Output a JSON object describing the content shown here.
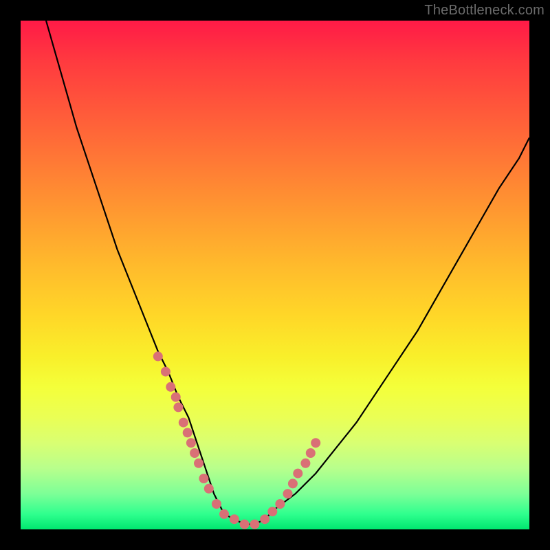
{
  "watermark": "TheBottleneck.com",
  "colors": {
    "frame": "#000000",
    "curve_stroke": "#000000",
    "dot_fill": "#d97076",
    "gradient_top": "#ff1a47",
    "gradient_bottom": "#00e66f"
  },
  "chart_data": {
    "type": "line",
    "title": "",
    "xlabel": "",
    "ylabel": "",
    "xlim": [
      0,
      100
    ],
    "ylim": [
      0,
      100
    ],
    "grid": false,
    "legend": false,
    "x": [
      5,
      7,
      9,
      11,
      13,
      15,
      17,
      19,
      21,
      23,
      25,
      27,
      29,
      31,
      33,
      34,
      35,
      36,
      37,
      38,
      39,
      40,
      42,
      44,
      46,
      48,
      50,
      54,
      58,
      62,
      66,
      70,
      74,
      78,
      82,
      86,
      90,
      94,
      98,
      100
    ],
    "values": [
      100,
      93,
      86,
      79,
      73,
      67,
      61,
      55,
      50,
      45,
      40,
      35,
      31,
      26,
      22,
      19,
      16,
      13,
      10,
      7,
      5,
      3,
      2,
      1,
      1,
      2,
      4,
      7,
      11,
      16,
      21,
      27,
      33,
      39,
      46,
      53,
      60,
      67,
      73,
      77
    ],
    "dots": {
      "x": [
        27,
        28.5,
        29.5,
        30.5,
        31,
        32,
        32.8,
        33.5,
        34.2,
        35,
        36,
        37,
        38.5,
        40,
        42,
        44,
        46,
        48,
        49.5,
        51,
        52.5,
        53.5,
        54.5,
        56,
        57,
        58
      ],
      "y": [
        34,
        31,
        28,
        26,
        24,
        21,
        19,
        17,
        15,
        13,
        10,
        8,
        5,
        3,
        2,
        1,
        1,
        2,
        3.5,
        5,
        7,
        9,
        11,
        13,
        15,
        17
      ]
    }
  }
}
